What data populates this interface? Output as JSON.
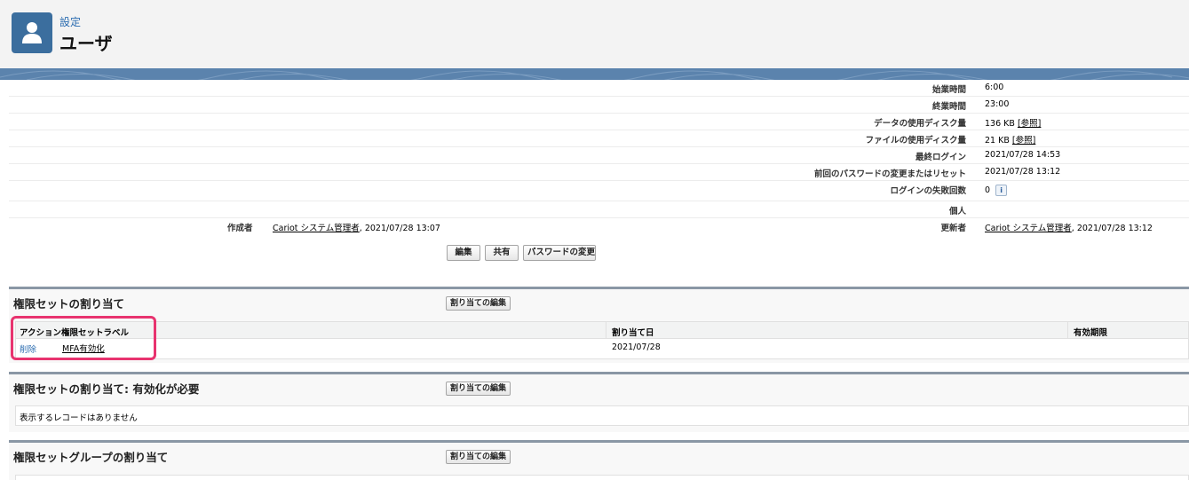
{
  "header": {
    "icon": "user-icon",
    "breadcrumb": "設定",
    "title": "ユーザ"
  },
  "details": [
    {
      "label": "始業時間",
      "value": "6:00"
    },
    {
      "label": "終業時間",
      "value": "23:00"
    },
    {
      "label": "データの使用ディスク量",
      "value": "136 KB",
      "link": "[参照]"
    },
    {
      "label": "ファイルの使用ディスク量",
      "value": "21 KB",
      "link": "[参照]"
    },
    {
      "label": "最終ログイン",
      "value": "2021/07/28 14:53"
    },
    {
      "label": "前回のパスワードの変更またはリセット",
      "value": "2021/07/28 13:12"
    },
    {
      "label": "ログインの失敗回数",
      "value": "0",
      "info": "i"
    },
    {
      "label": "個人",
      "value": ""
    }
  ],
  "created": {
    "label": "作成者",
    "user": "Cariot システム管理者",
    "date": ", 2021/07/28 13:07"
  },
  "modified": {
    "label": "更新者",
    "user": "Cariot システム管理者",
    "date": ", 2021/07/28 13:12"
  },
  "buttons": {
    "edit": "編集",
    "share": "共有",
    "change_password": "パスワードの変更"
  },
  "permission_sets": {
    "title": "権限セットの割り当て",
    "edit_button": "割り当ての編集",
    "columns": [
      "アクション",
      "権限セットラベル",
      "割り当て日",
      "有効期限"
    ],
    "rows": [
      {
        "action": "削除",
        "label": "MFA有効化",
        "date": "2021/07/28",
        "expires": ""
      }
    ]
  },
  "permission_sets_activation": {
    "title": "権限セットの割り当て: 有効化が必要",
    "edit_button": "割り当ての編集",
    "empty_text": "表示するレコードはありません"
  },
  "permission_set_groups": {
    "title": "権限セットグループの割り当て",
    "edit_button": "割り当ての編集"
  },
  "colors": {
    "header_icon_bg": "#3b6e9e",
    "band": "#5b83ad",
    "highlight": "#e8336f"
  }
}
